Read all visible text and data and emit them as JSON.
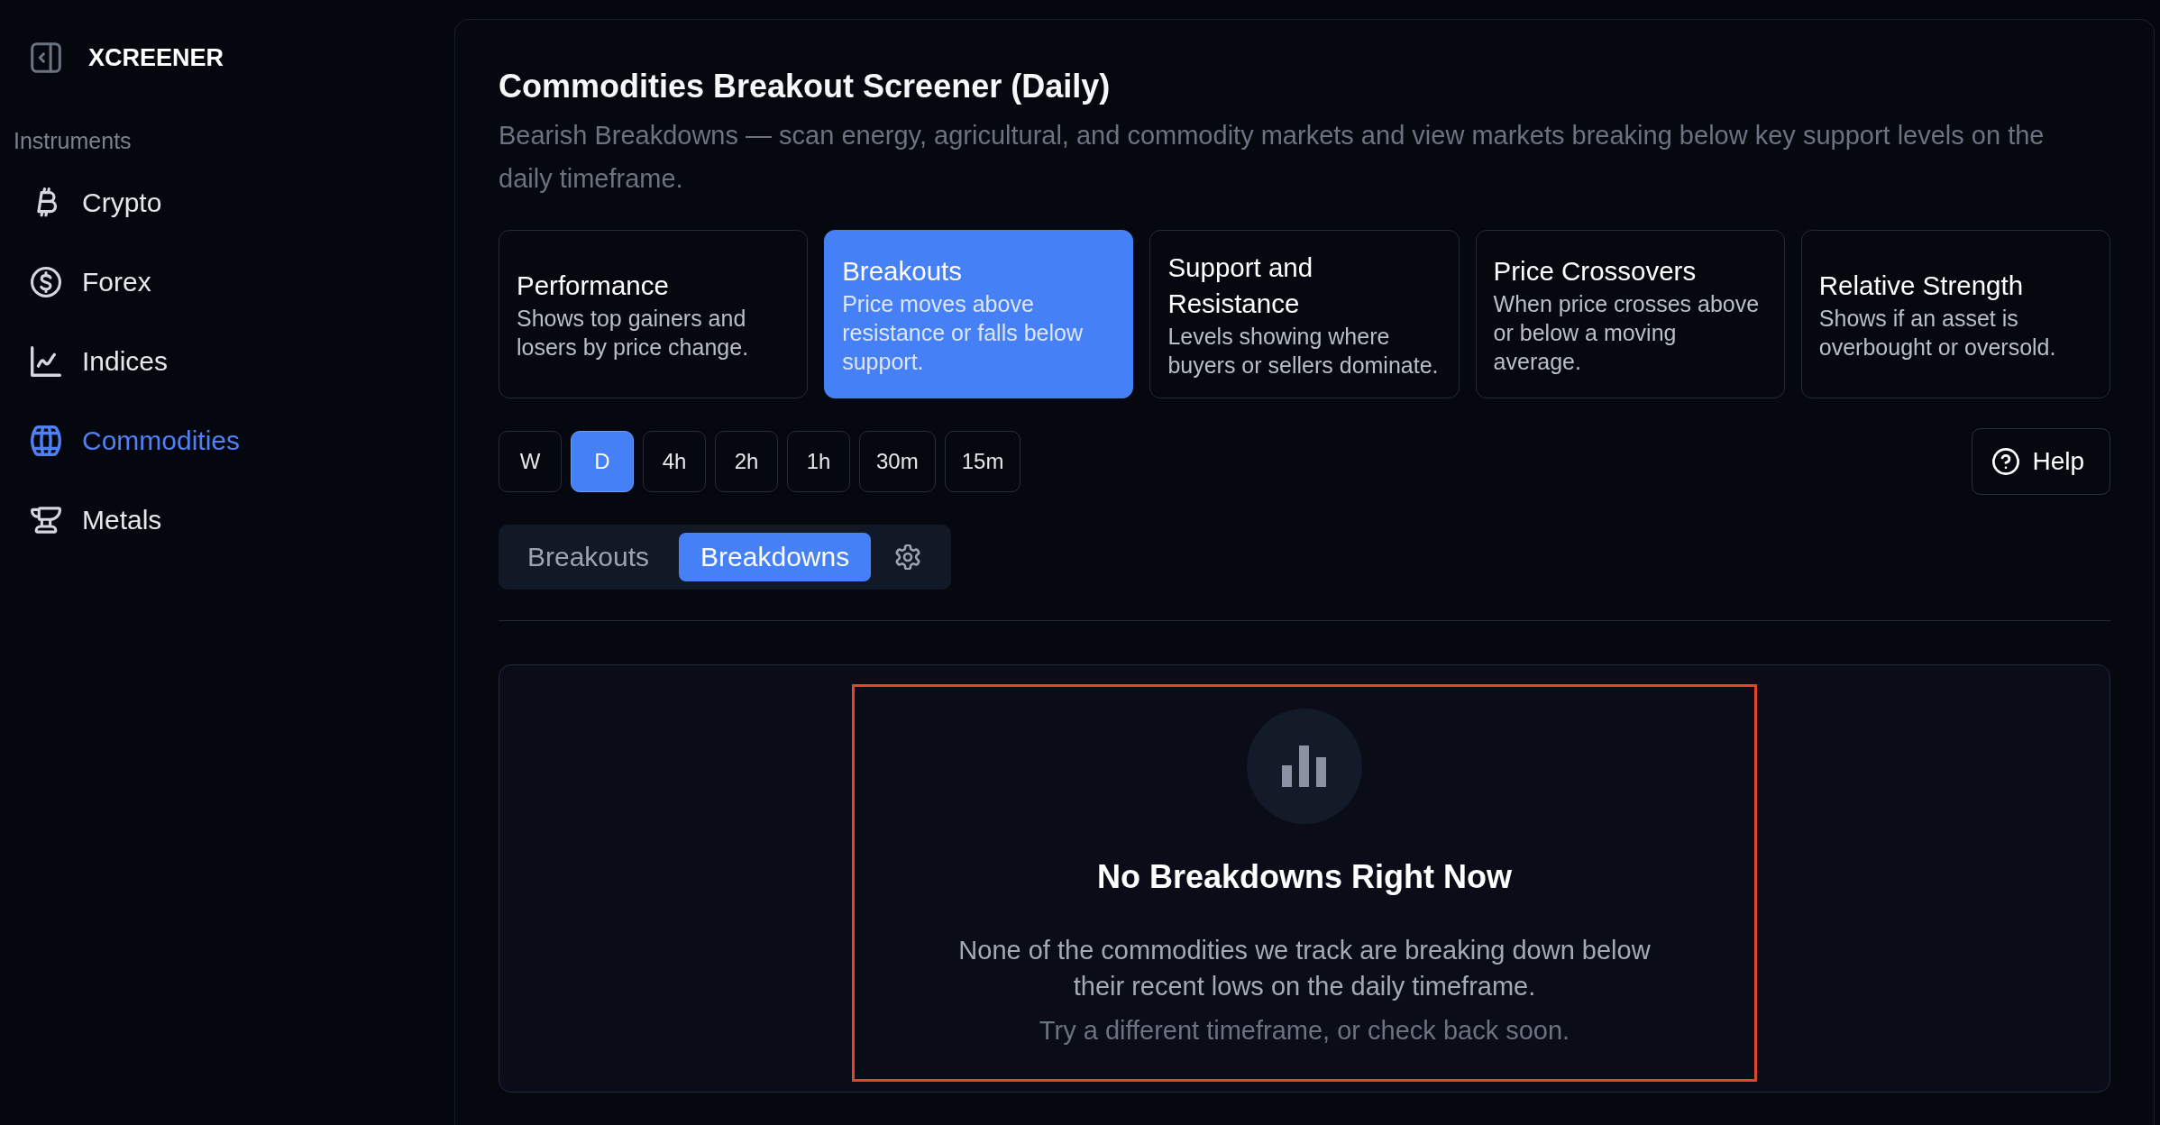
{
  "sidebar": {
    "brand": "XCREENER",
    "section_label": "Instruments",
    "items": [
      {
        "label": "Crypto",
        "selected": false
      },
      {
        "label": "Forex",
        "selected": false
      },
      {
        "label": "Indices",
        "selected": false
      },
      {
        "label": "Commodities",
        "selected": true
      },
      {
        "label": "Metals",
        "selected": false
      }
    ]
  },
  "header": {
    "title": "Commodities Breakout Screener (Daily)",
    "subtitle": "Bearish Breakdowns — scan energy, agricultural, and commodity markets and view markets breaking below key support levels on the daily timeframe."
  },
  "screener_cards": [
    {
      "title": "Performance",
      "description": "Shows top gainers and losers by price change.",
      "selected": false
    },
    {
      "title": "Breakouts",
      "description": "Price moves above resistance or falls below support.",
      "selected": true
    },
    {
      "title": "Support and Resistance",
      "description": "Levels showing where buyers or sellers dominate.",
      "selected": false
    },
    {
      "title": "Price Crossovers",
      "description": "When price crosses above or below a moving average.",
      "selected": false
    },
    {
      "title": "Relative Strength",
      "description": "Shows if an asset is overbought or oversold.",
      "selected": false
    }
  ],
  "timeframes": [
    {
      "label": "W",
      "selected": false
    },
    {
      "label": "D",
      "selected": true
    },
    {
      "label": "4h",
      "selected": false
    },
    {
      "label": "2h",
      "selected": false
    },
    {
      "label": "1h",
      "selected": false
    },
    {
      "label": "30m",
      "selected": false
    },
    {
      "label": "15m",
      "selected": false
    }
  ],
  "help_button": {
    "label": "Help"
  },
  "direction_toggle": [
    {
      "label": "Breakouts",
      "selected": false
    },
    {
      "label": "Breakdowns",
      "selected": true
    }
  ],
  "empty_state": {
    "highlighted": true,
    "title": "No Breakdowns Right Now",
    "message": "None of the commodities we track are breaking down below their recent lows on the daily timeframe.",
    "hint": "Try a different timeframe, or check back soon."
  }
}
